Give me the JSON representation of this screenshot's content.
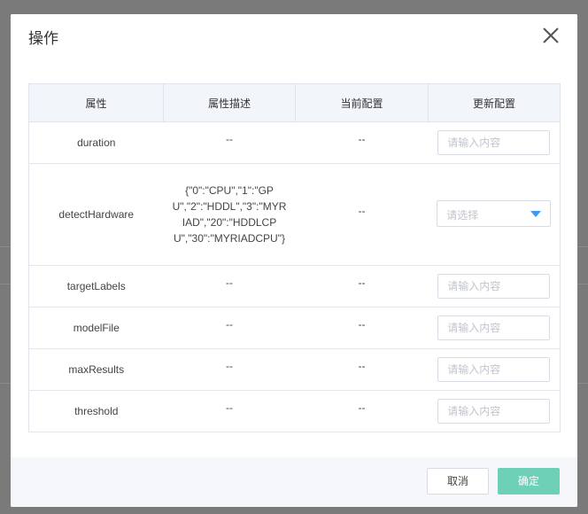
{
  "dialog": {
    "title": "操作"
  },
  "table": {
    "headers": [
      "属性",
      "属性描述",
      "当前配置",
      "更新配置"
    ],
    "rows": [
      {
        "name": "duration",
        "desc": "--",
        "current": "--",
        "control": "input",
        "placeholder": "请输入内容"
      },
      {
        "name": "detectHardware",
        "desc": "{\"0\":\"CPU\",\"1\":\"GPU\",\"2\":\"HDDL\",\"3\":\"MYRIAD\",\"20\":\"HDDLCPU\",\"30\":\"MYRIADCPU\"}",
        "current": "--",
        "control": "select",
        "placeholder": "请选择"
      },
      {
        "name": "targetLabels",
        "desc": "--",
        "current": "--",
        "control": "input",
        "placeholder": "请输入内容"
      },
      {
        "name": "modelFile",
        "desc": "--",
        "current": "--",
        "control": "input",
        "placeholder": "请输入内容"
      },
      {
        "name": "maxResults",
        "desc": "--",
        "current": "--",
        "control": "input",
        "placeholder": "请输入内容"
      },
      {
        "name": "threshold",
        "desc": "--",
        "current": "--",
        "control": "input",
        "placeholder": "请输入内容"
      }
    ]
  },
  "footer": {
    "cancel_label": "取消",
    "ok_label": "确定"
  },
  "colors": {
    "overlay": "#7a7a7a",
    "header_bg": "#f2f5f9",
    "footer_bg": "#f5f7fa",
    "primary": "#6fd0b8",
    "caret": "#3e9af0"
  },
  "icons": {
    "close": "close-icon",
    "dropdown": "chevron-down-icon"
  }
}
